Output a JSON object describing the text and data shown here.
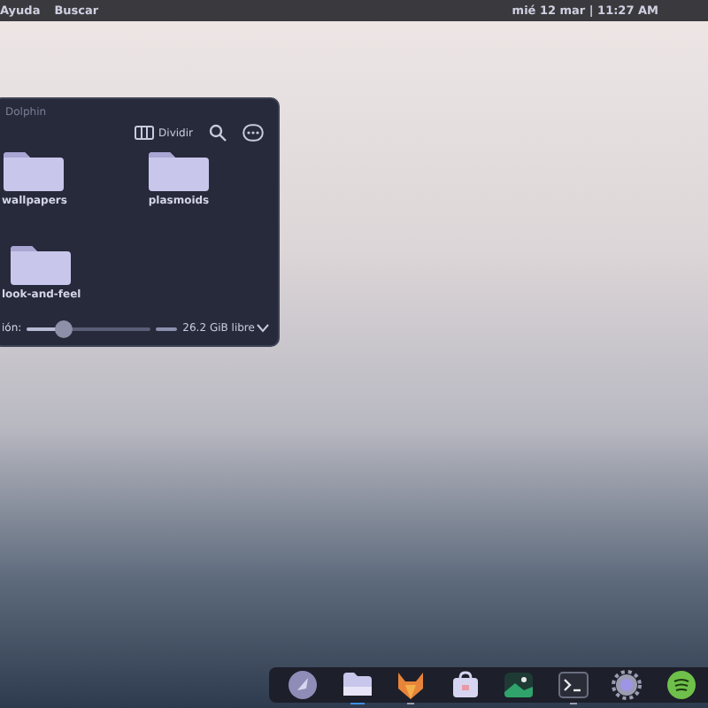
{
  "top_bar": {
    "menu": [
      "Ayuda",
      "Buscar"
    ],
    "clock": "mié 12 mar | 11:27 AM"
  },
  "window": {
    "title": "Dolphin",
    "toolbar": {
      "split_label": "Dividir"
    },
    "files": [
      {
        "name": "wallpapers"
      },
      {
        "name": "plasmoids"
      },
      {
        "name": "look-and-feel"
      }
    ],
    "status_bar": {
      "zoom_label": "ión:",
      "zoom": {
        "level": 0.3
      },
      "free_space": "26.2 GiB libre"
    }
  },
  "dock": [
    {
      "kind": "round",
      "running": false
    },
    {
      "kind": "files",
      "running": true,
      "focused": true
    },
    {
      "kind": "fox",
      "running": true
    },
    {
      "kind": "store",
      "running": false
    },
    {
      "kind": "image",
      "running": false
    },
    {
      "kind": "terminal",
      "running": true
    },
    {
      "kind": "gear",
      "running": false
    },
    {
      "kind": "music",
      "running": false
    }
  ]
}
